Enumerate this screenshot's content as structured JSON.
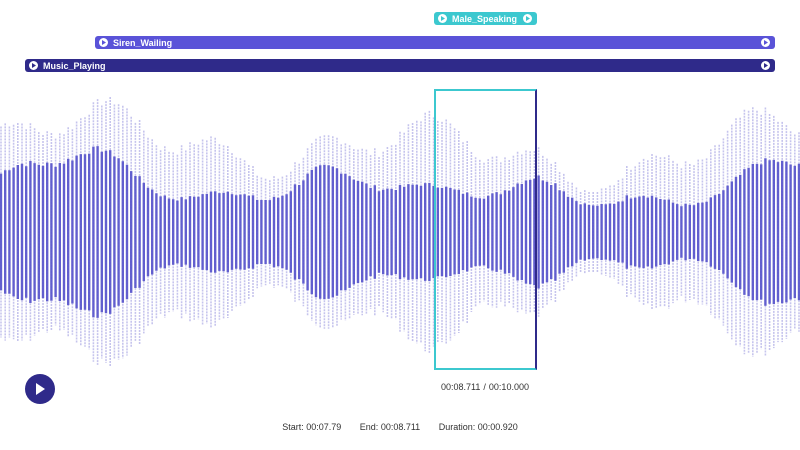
{
  "labels": [
    {
      "id": "male",
      "text": "Male_Speaking",
      "color": "#3cc8cf"
    },
    {
      "id": "siren",
      "text": "Siren_Wailing",
      "color": "#5a53d8"
    },
    {
      "id": "music",
      "text": "Music_Playing",
      "color": "#2f2a8a"
    }
  ],
  "waveform": {
    "color": "#5b57cc"
  },
  "selection": {
    "start_color": "#3cc8cf",
    "end_color": "#2f2a8a"
  },
  "player": {
    "play_color": "#2f2a8a",
    "current_time": "00:08.711",
    "separator": "/",
    "total_time": "00:10.000"
  },
  "stats": {
    "start_label": "Start:",
    "start_value": "00:07.79",
    "end_label": "End:",
    "end_value": "00:08.711",
    "duration_label": "Duration:",
    "duration_value": "00:00.920"
  }
}
